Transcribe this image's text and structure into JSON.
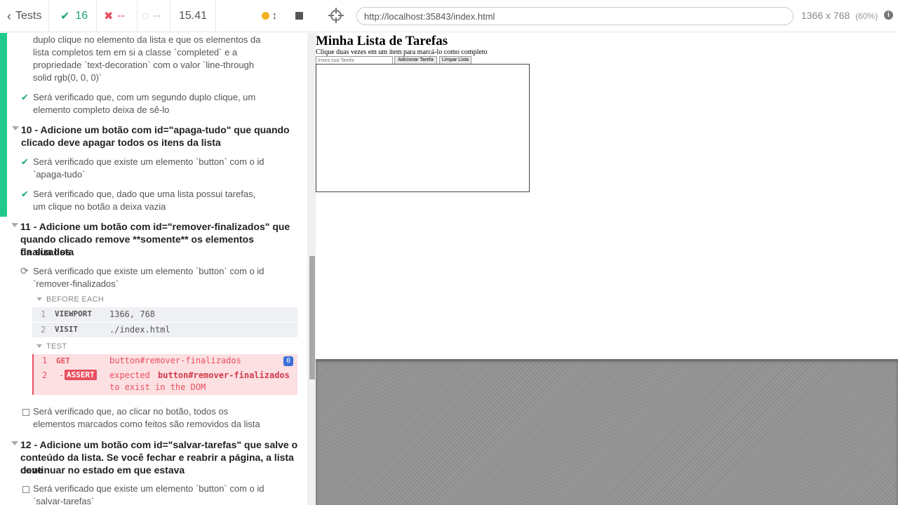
{
  "reporter": {
    "tests_label": "Tests",
    "passed_count": "16",
    "failed_count": "--",
    "pending_count": "--",
    "duration": "15.41"
  },
  "suite9": {
    "test_cont_line1": "duplo clique no elemento da lista e que os elementos da",
    "test_cont_line2": "lista completos tem em si a classe `completed` e a",
    "test_cont_line3": "propriedade `text-decoration` com o valor `line-through",
    "test_cont_line4": "solid rgb(0, 0, 0)`",
    "test2_line1": "Será verificado que, com um segundo duplo clique, um",
    "test2_line2": "elemento completo deixa de sê-lo"
  },
  "suite10": {
    "title_line1": "10 - Adicione um botão com id=\"apaga-tudo\" que quando",
    "title_line2": "clicado deve apagar todos os itens da lista",
    "test1_line1": "Será verificado que existe um elemento `button` com o id",
    "test1_line2": "`apaga-tudo`",
    "test2_line1": "Será verificado que, dado que uma lista possui tarefas,",
    "test2_line2": "um clique no botão a deixa vazia"
  },
  "suite11": {
    "title_line1": "11 - Adicione um botão com id=\"remover-finalizados\" que",
    "title_line2": "quando clicado remove **somente** os elementos finalizados",
    "title_line3": "da sua lista",
    "test1_line1": "Será verificado que existe um elemento `button` com o id",
    "test1_line2": "`remover-finalizados`",
    "before_each_label": "BEFORE EACH",
    "cmd1": {
      "num": "1",
      "name": "VIEWPORT",
      "msg": "1366, 768"
    },
    "cmd2": {
      "num": "2",
      "name": "VISIT",
      "msg": "./index.html"
    },
    "test_label": "TEST",
    "cmd3": {
      "num": "1",
      "name": "GET",
      "msg": "button#remover-finalizados",
      "count": "0"
    },
    "cmd4": {
      "num": "2",
      "prefix": "-",
      "name": "ASSERT",
      "msg_pre": "expected",
      "msg_selector": "button#remover-finalizados",
      "msg_post": "to exist in the DOM"
    },
    "test2_line1": "Será verificado que, ao clicar no botão, todos os",
    "test2_line2": "elementos marcados como feitos são removidos da lista"
  },
  "suite12": {
    "title_line1": "12 - Adicione um botão com id=\"salvar-tarefas\" que salve o",
    "title_line2": "conteúdo da lista. Se você fechar e reabrir a página, a lista deve",
    "title_line3": "continuar no estado em que estava",
    "test1_line1": "Será verificado que existe um elemento `button` com o id",
    "test1_line2": "`salvar-tarefas`"
  },
  "preview": {
    "url": "http://localhost:35843/index.html",
    "viewport": "1366 x 768",
    "zoom": "(60%)"
  },
  "app": {
    "title": "Minha Lista de Tarefas",
    "subtitle": "Clique duas vezes em um item para marcá-lo como completo",
    "input_placeholder": "Insira sua Tarefa",
    "add_button": "Adicionar Tarefa",
    "clear_button": "Limpar Lista"
  },
  "colors": {
    "pass": "#1fa971",
    "fail": "#e94f5f",
    "pending": "#f5b021"
  },
  "icons": [
    "chevron-left-icon",
    "check-icon",
    "x-icon",
    "spinner-icon",
    "orange-dot-icon",
    "resize-icon",
    "stop-icon",
    "crosshair-icon",
    "info-icon"
  ]
}
